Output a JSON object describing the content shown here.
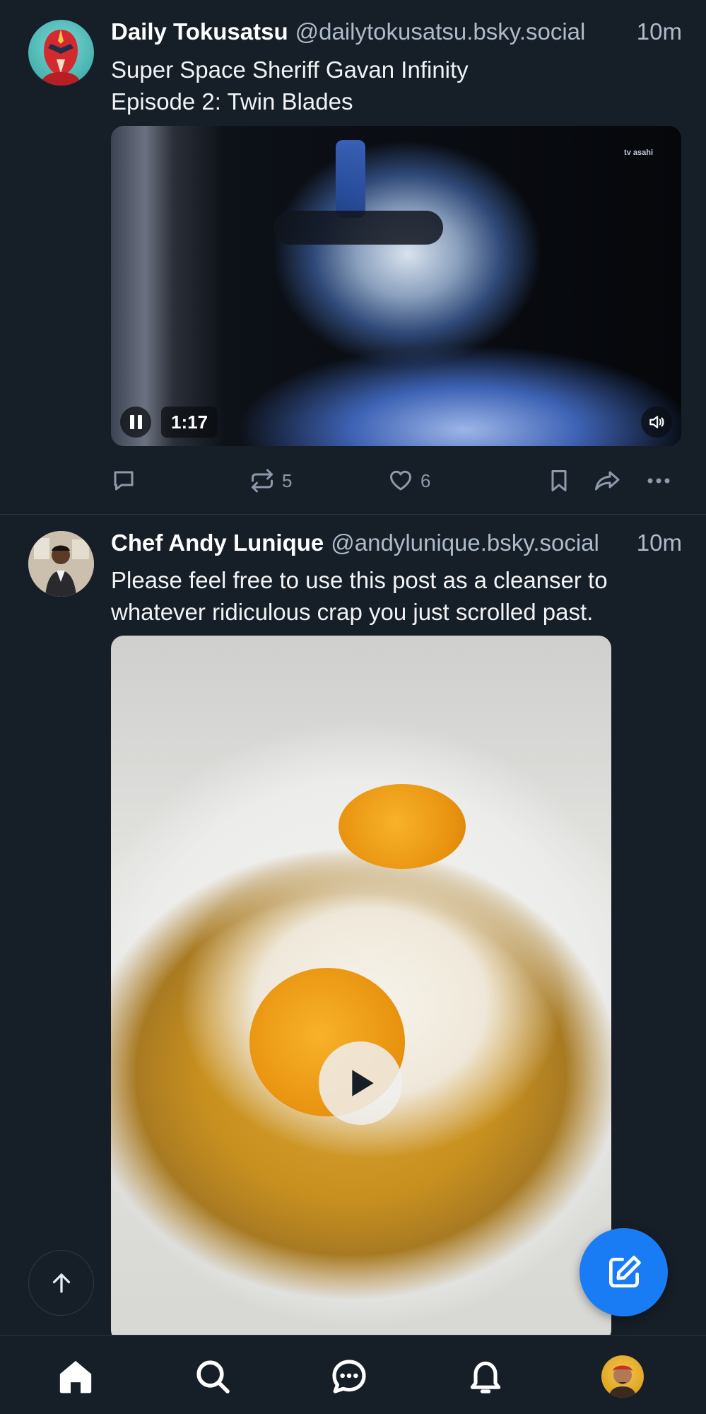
{
  "posts": [
    {
      "author_name": "Daily Tokusatsu",
      "handle": "@dailytokusatsu.bsky.social",
      "time": "10m",
      "text_lines": [
        "Super Space Sheriff Gavan Infinity",
        "Episode 2: Twin Blades"
      ],
      "video": {
        "duration": "1:17",
        "watermark": "tv asahi",
        "state": "playing"
      },
      "actions": {
        "reply_count": "",
        "repost_count": "5",
        "like_count": "6"
      }
    },
    {
      "author_name": "Chef Andy Lunique",
      "handle": "@andylunique.bsky.social",
      "time": "10m",
      "text_lines": [
        "Please feel free to use this post as a cleanser to",
        "whatever ridiculous crap you just scrolled past."
      ],
      "video": {
        "state": "paused"
      }
    }
  ],
  "icons": {
    "reply": "reply-icon",
    "repost": "repost-icon",
    "like": "heart-icon",
    "bookmark": "bookmark-icon",
    "share": "share-icon",
    "more": "more-icon",
    "scroll_top": "arrow-up-icon",
    "compose": "compose-icon"
  },
  "bottom_nav": [
    "home",
    "search",
    "chat",
    "notifications",
    "profile"
  ],
  "colors": {
    "background": "#161e27",
    "accent": "#1a7cf5",
    "muted_text": "#aebbc9",
    "icon_muted": "#8d9aab"
  }
}
